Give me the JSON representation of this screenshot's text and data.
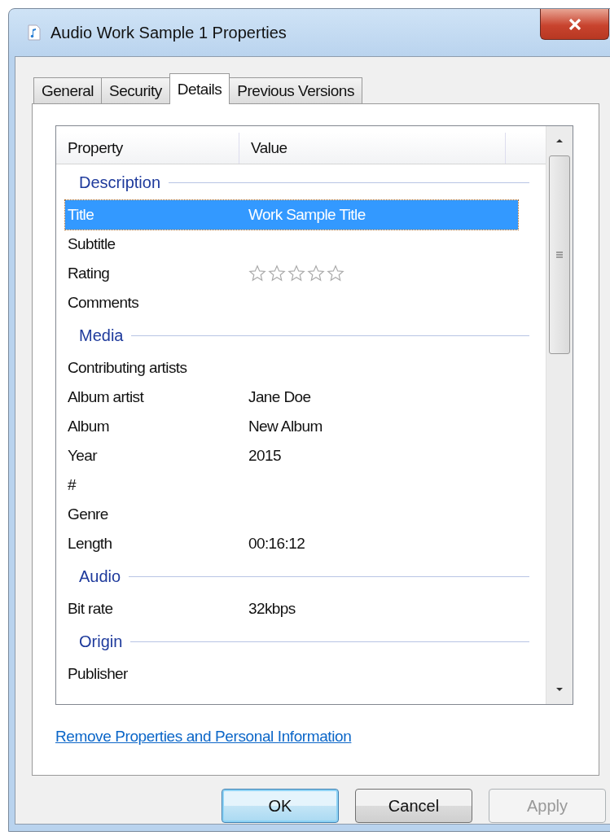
{
  "window": {
    "title": "Audio Work Sample 1 Properties"
  },
  "tabs": [
    {
      "label": "General",
      "selected": false
    },
    {
      "label": "Security",
      "selected": false
    },
    {
      "label": "Details",
      "selected": true
    },
    {
      "label": "Previous Versions",
      "selected": false
    }
  ],
  "table": {
    "columns": [
      "Property",
      "Value"
    ],
    "groups": [
      {
        "label": "Description",
        "rows": [
          {
            "kind": "text",
            "property": "Title",
            "value": "Work Sample Title",
            "selected": true
          },
          {
            "kind": "text",
            "property": "Subtitle",
            "selected": false
          },
          {
            "kind": "rating",
            "property": "Rating",
            "stars": 0,
            "selected": false
          },
          {
            "kind": "text",
            "property": "Comments",
            "selected": false
          }
        ]
      },
      {
        "label": "Media",
        "rows": [
          {
            "kind": "text",
            "property": "Contributing artists",
            "selected": false
          },
          {
            "kind": "text",
            "property": "Album artist",
            "value": "Jane Doe",
            "selected": false
          },
          {
            "kind": "text",
            "property": "Album",
            "value": "New Album",
            "selected": false
          },
          {
            "kind": "text",
            "property": "Year",
            "value": "2015",
            "selected": false
          },
          {
            "kind": "text",
            "property": "#",
            "selected": false
          },
          {
            "kind": "text",
            "property": "Genre",
            "selected": false
          },
          {
            "kind": "text",
            "property": "Length",
            "value": "00:16:12",
            "selected": false
          }
        ]
      },
      {
        "label": "Audio",
        "rows": [
          {
            "kind": "text",
            "property": "Bit rate",
            "value": "32kbps",
            "selected": false
          }
        ]
      },
      {
        "label": "Origin",
        "rows": [
          {
            "kind": "text",
            "property": "Publisher",
            "selected": false
          }
        ]
      }
    ]
  },
  "link": "Remove Properties and Personal Information",
  "buttons": [
    {
      "label": "OK",
      "disabled": false,
      "default": true
    },
    {
      "label": "Cancel",
      "disabled": false,
      "default": false
    },
    {
      "label": "Apply",
      "disabled": true,
      "default": false
    }
  ]
}
